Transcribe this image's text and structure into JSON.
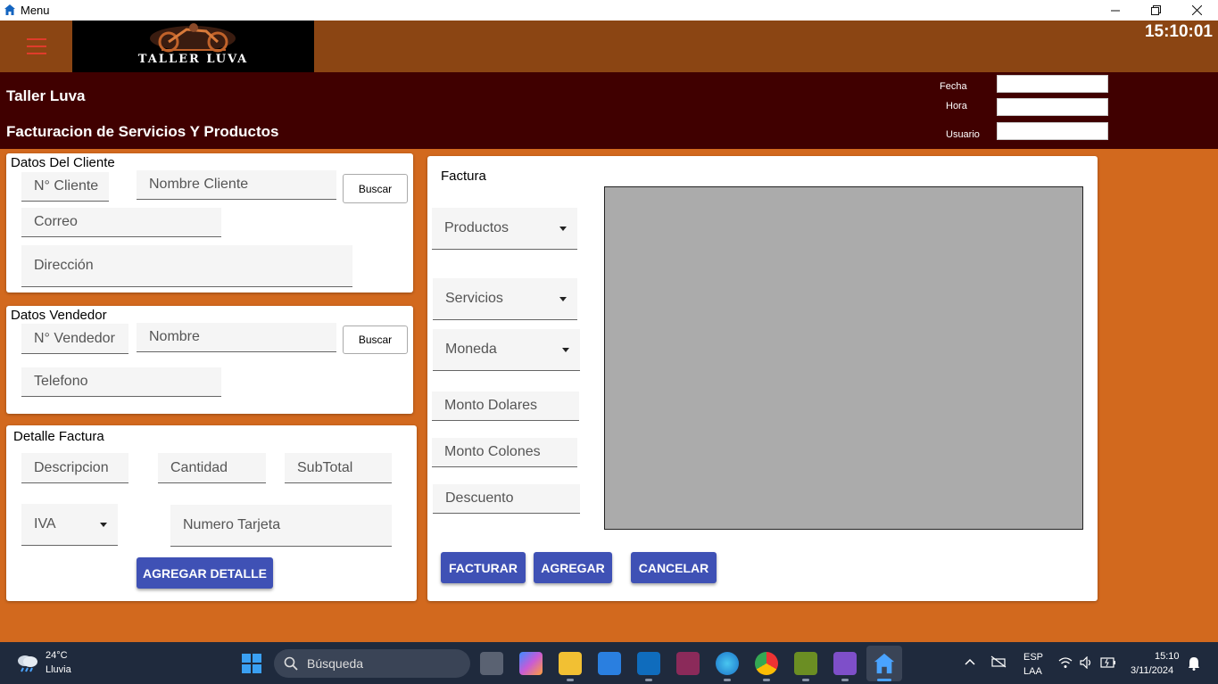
{
  "window": {
    "title": "Menu"
  },
  "header": {
    "logo_text": "TALLER LUVA",
    "clock": "15:10:01"
  },
  "subheader": {
    "app_name": "Taller Luva",
    "section_title": "Facturacion de Servicios Y Productos",
    "fecha_label": "Fecha",
    "hora_label": "Hora",
    "usuario_label": "Usuario",
    "fecha_value": "",
    "hora_value": "",
    "usuario_value": ""
  },
  "cliente": {
    "title": "Datos Del Cliente",
    "numero_placeholder": "N° Cliente",
    "nombre_placeholder": "Nombre Cliente",
    "buscar_label": "Buscar",
    "correo_placeholder": "Correo",
    "direccion_placeholder": "Dirección"
  },
  "vendedor": {
    "title": "Datos Vendedor",
    "numero_placeholder": "N° Vendedor",
    "nombre_placeholder": "Nombre",
    "buscar_label": "Buscar",
    "telefono_placeholder": "Telefono"
  },
  "detalle": {
    "title": "Detalle Factura",
    "descripcion_placeholder": "Descripcion",
    "cantidad_placeholder": "Cantidad",
    "subtotal_placeholder": "SubTotal",
    "iva_placeholder": "IVA",
    "tarjeta_placeholder": "Numero Tarjeta",
    "agregar_detalle_label": "AGREGAR DETALLE"
  },
  "factura": {
    "title": "Factura",
    "productos_placeholder": "Productos",
    "servicios_placeholder": "Servicios",
    "moneda_placeholder": "Moneda",
    "monto_dolares_placeholder": "Monto Dolares",
    "monto_colones_placeholder": "Monto Colones",
    "descuento_placeholder": "Descuento",
    "facturar_label": "FACTURAR",
    "agregar_label": "AGREGAR",
    "cancelar_label": "CANCELAR"
  },
  "taskbar": {
    "weather_temp": "24°C",
    "weather_desc": "Lluvia",
    "search_placeholder": "Búsqueda",
    "lang_top": "ESP",
    "lang_bottom": "LAA",
    "time": "15:10",
    "date": "3/11/2024",
    "icons": [
      "task-view-icon",
      "copilot-icon",
      "file-explorer-icon",
      "microsoft-store-icon",
      "outlook-icon",
      "winrar-icon",
      "edge-icon",
      "chrome-icon",
      "snipping-tool-icon",
      "visual-studio-icon",
      "taller-app-icon"
    ]
  },
  "colors": {
    "background": "#d2691e",
    "header": "#8b4513",
    "subheader": "#400000",
    "button_primary": "#3f51b5",
    "hamburger": "#e03c2b"
  }
}
